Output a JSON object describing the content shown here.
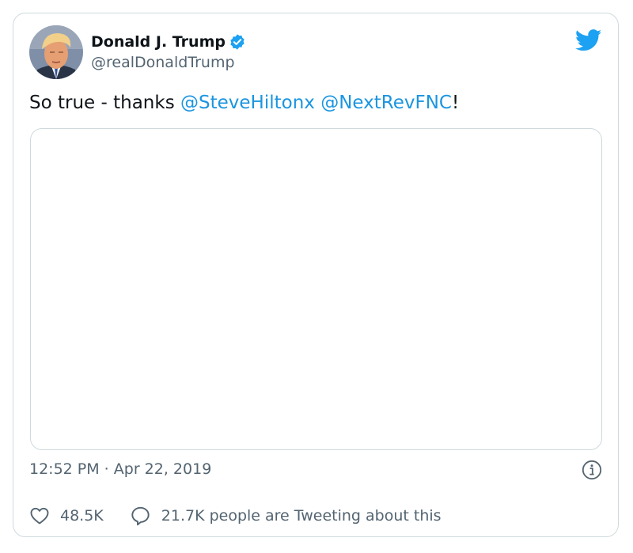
{
  "author": {
    "name": "Donald J. Trump",
    "handle": "@realDonaldTrump",
    "verified": true,
    "avatar_icon": "profile-photo"
  },
  "brand": {
    "icon": "twitter-bird-icon",
    "color": "#1da1f2"
  },
  "tweet": {
    "text_prefix": "So true - thanks ",
    "mention_1": "@SteveHiltonx",
    "separator": " ",
    "mention_2": "@NextRevFNC",
    "text_suffix": "!",
    "mention_color": "#1b95e0"
  },
  "meta": {
    "timestamp": "12:52 PM · Apr 22, 2019",
    "info_icon": "info-icon"
  },
  "actions": {
    "likes": "48.5K",
    "conversation": "21.7K people are Tweeting about this"
  }
}
